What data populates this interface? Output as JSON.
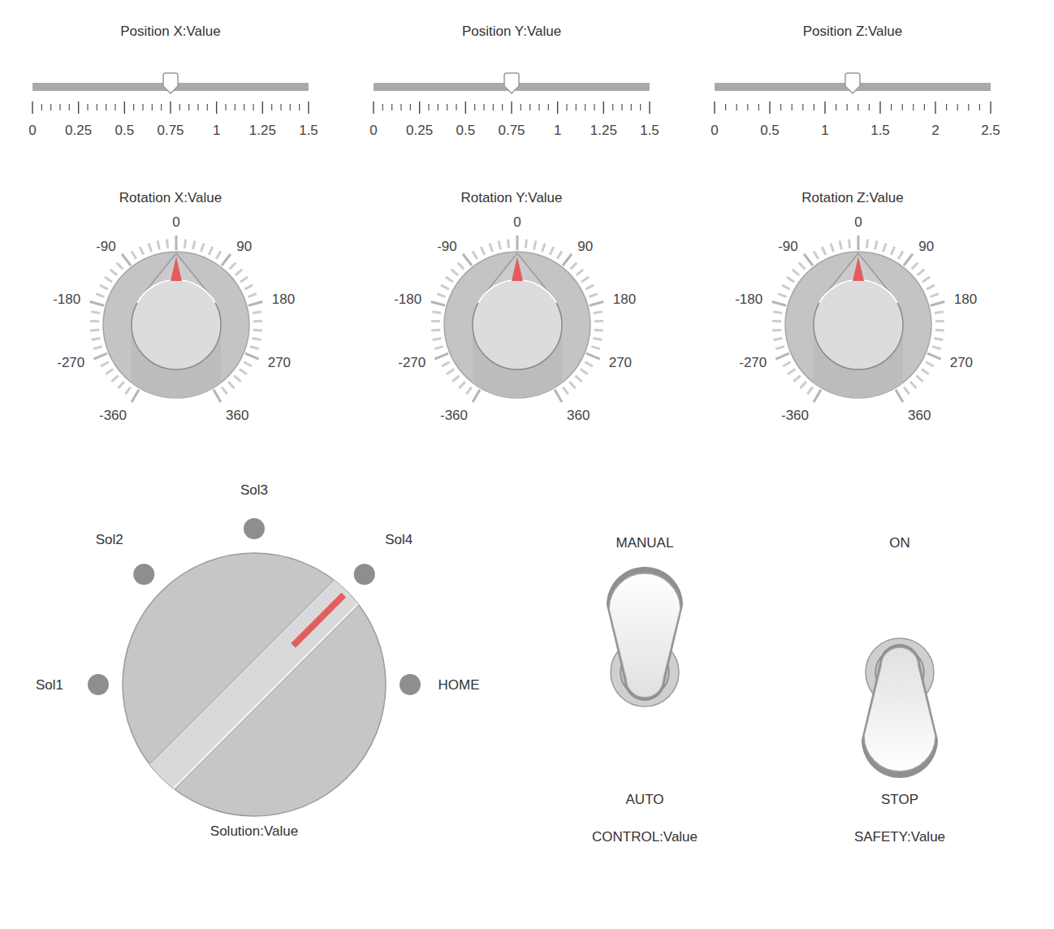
{
  "sliders": [
    {
      "label": "Position X:Value",
      "level": 0.5,
      "ticks": [
        "0",
        "0.25",
        "0.5",
        "0.75",
        "1",
        "1.25",
        "1.5"
      ]
    },
    {
      "label": "Position Y:Value",
      "level": 0.5,
      "ticks": [
        "0",
        "0.25",
        "0.5",
        "0.75",
        "1",
        "1.25",
        "1.5"
      ]
    },
    {
      "label": "Position Z:Value",
      "level": 0.5,
      "ticks": [
        "0",
        "0.5",
        "1",
        "1.5",
        "2",
        "2.5"
      ]
    }
  ],
  "knobs": [
    {
      "label": "Rotation X:Value",
      "level": 0.5,
      "ticks": [
        "-360",
        "-270",
        "-180",
        "-90",
        "0",
        "90",
        "180",
        "270",
        "360"
      ]
    },
    {
      "label": "Rotation Y:Value",
      "level": 0.5,
      "ticks": [
        "-360",
        "-270",
        "-180",
        "-90",
        "0",
        "90",
        "180",
        "270",
        "360"
      ]
    },
    {
      "label": "Rotation Z:Value",
      "level": 0.5,
      "ticks": [
        "-360",
        "-270",
        "-180",
        "-90",
        "0",
        "90",
        "180",
        "270",
        "360"
      ]
    }
  ],
  "selector": {
    "label": "Solution:Value",
    "options": [
      {
        "label": "Sol1",
        "selected": false
      },
      {
        "label": "Sol2",
        "selected": false
      },
      {
        "label": "Sol3",
        "selected": false
      },
      {
        "label": "Sol4",
        "selected": true
      },
      {
        "label": "HOME",
        "selected": false
      }
    ]
  },
  "switches": [
    {
      "label": "CONTROL:Value",
      "options": [
        {
          "label": "MANUAL",
          "selected": true
        },
        {
          "label": "AUTO",
          "selected": false
        }
      ]
    },
    {
      "label": "SAFETY:Value",
      "options": [
        {
          "label": "ON",
          "selected": false
        },
        {
          "label": "STOP",
          "selected": true
        }
      ]
    }
  ]
}
